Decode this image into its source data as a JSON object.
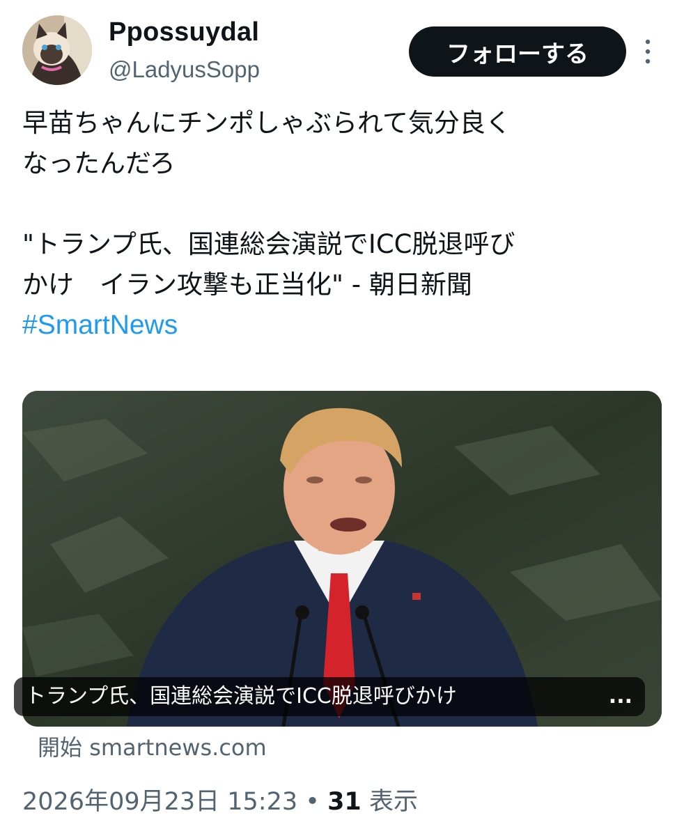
{
  "user": {
    "display_name": "Ppossuydal",
    "handle": "@LadyusSopp",
    "follow_label": "フォローする"
  },
  "tweet": {
    "line1": "早苗ちゃんにチンポしゃぶられて気分良く",
    "line2": "なったんだろ",
    "quote_line1": "\"トランプ氏、国連総会演説でICC脱退呼び",
    "quote_line2": "かけ　イラン攻撃も正当化\" - 朝日新聞",
    "hashtag": "#SmartNews"
  },
  "card": {
    "title": "トランプ氏、国連総会演説でICC脱退呼びかけ",
    "ellipsis": "...",
    "source_prefix": "開始",
    "source_domain": "smartnews.com"
  },
  "meta": {
    "timestamp": "2026年09月23日 15:23",
    "separator": "•",
    "views_count": "31",
    "views_label": "表示"
  },
  "colors": {
    "link": "#1d9bf0",
    "secondary_text": "#536471",
    "primary_text": "#0f1419",
    "follow_bg": "#0f1419"
  },
  "icons": {
    "more": "more-vertical-icon"
  }
}
